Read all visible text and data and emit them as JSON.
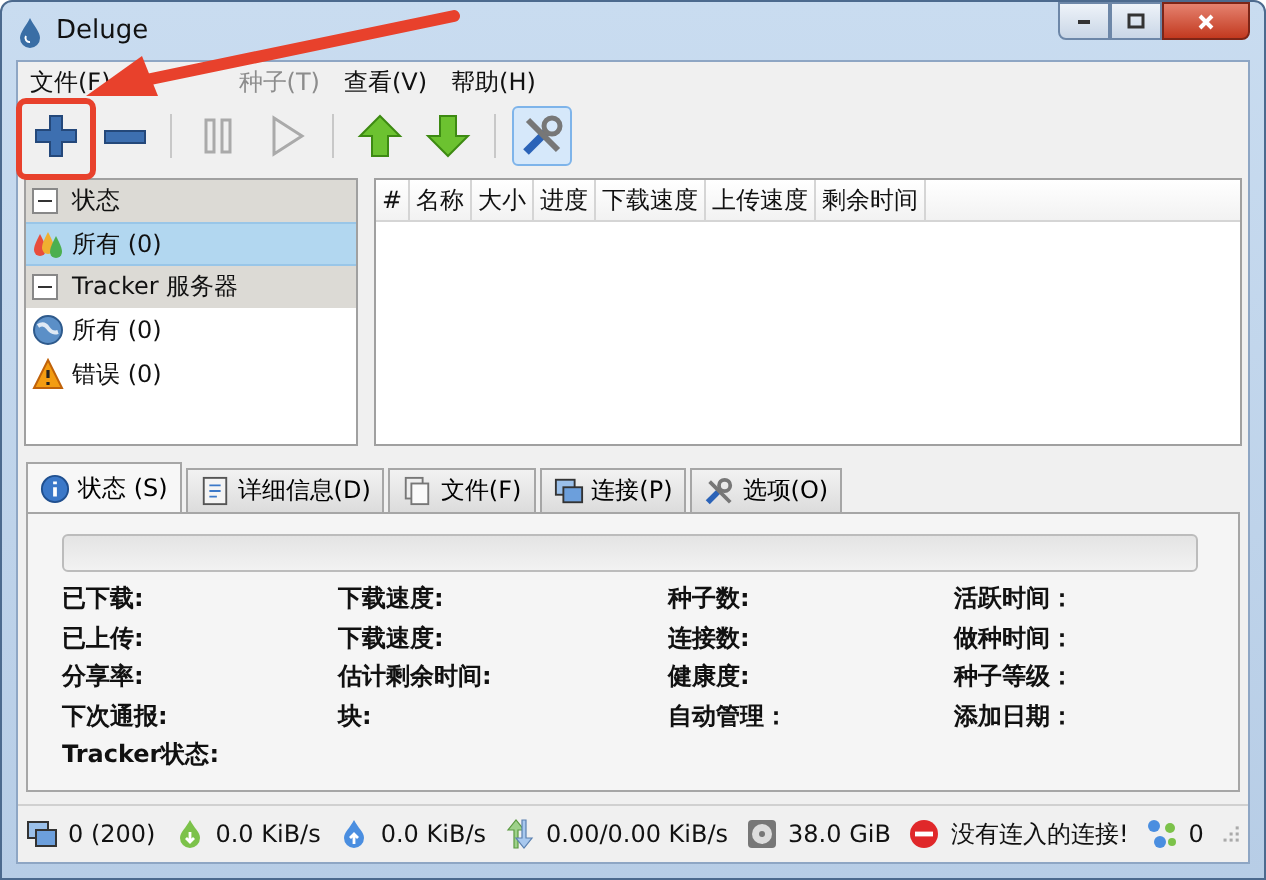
{
  "window": {
    "title": "Deluge"
  },
  "menu": [
    {
      "label": "文件(F)",
      "disabled": false
    },
    {
      "label": "种子(T)",
      "disabled": true
    },
    {
      "label": "查看(V)",
      "disabled": false
    },
    {
      "label": "帮助(H)",
      "disabled": false
    }
  ],
  "toolbar": [
    {
      "kind": "add",
      "disabled": false,
      "pressed": false
    },
    {
      "kind": "remove",
      "disabled": false,
      "pressed": false
    },
    {
      "kind": "separator"
    },
    {
      "kind": "pause",
      "disabled": true,
      "pressed": false
    },
    {
      "kind": "resume",
      "disabled": true,
      "pressed": false
    },
    {
      "kind": "separator"
    },
    {
      "kind": "up",
      "disabled": false,
      "pressed": false
    },
    {
      "kind": "down",
      "disabled": false,
      "pressed": false
    },
    {
      "kind": "separator"
    },
    {
      "kind": "preferences",
      "disabled": false,
      "pressed": true
    }
  ],
  "sidebar": {
    "groups": [
      {
        "label": "状态",
        "expanded": true,
        "items": [
          {
            "label": "所有 (0)",
            "kind": "all",
            "selected": true
          }
        ]
      },
      {
        "label": "Tracker 服务器",
        "expanded": true,
        "items": [
          {
            "label": "所有 (0)",
            "kind": "globe",
            "selected": false
          },
          {
            "label": "错误 (0)",
            "kind": "warning",
            "selected": false
          }
        ]
      }
    ]
  },
  "table": {
    "columns": [
      "#",
      "名称",
      "大小",
      "进度",
      "下载速度",
      "上传速度",
      "剩余时间"
    ]
  },
  "tabs": [
    {
      "label": "状态 (S)",
      "kind": "info",
      "selected": true
    },
    {
      "label": "详细信息(D)",
      "kind": "details",
      "selected": false
    },
    {
      "label": "文件(F)",
      "kind": "files",
      "selected": false
    },
    {
      "label": "连接(P)",
      "kind": "peers",
      "selected": false
    },
    {
      "label": "选项(O)",
      "kind": "options",
      "selected": false
    }
  ],
  "details": {
    "progress": {
      "level": 0
    },
    "columns": [
      [
        "已下载:",
        "已上传:",
        "分享率:",
        "下次通报:",
        "Tracker状态:"
      ],
      [
        "下载速度:",
        "下载速度:",
        "估计剩余时间:",
        "块:"
      ],
      [
        "种子数:",
        "连接数:",
        "健康度:",
        "自动管理："
      ],
      [
        "活跃时间：",
        "做种时间：",
        "种子等级：",
        "添加日期："
      ]
    ]
  },
  "status_bar": [
    {
      "kind": "connections",
      "text": "0 (200)"
    },
    {
      "kind": "download",
      "text": "0.0 KiB/s"
    },
    {
      "kind": "upload",
      "text": "0.0 KiB/s"
    },
    {
      "kind": "protocol",
      "text": "0.00/0.00 KiB/s"
    },
    {
      "kind": "disk",
      "text": "38.0 GiB"
    },
    {
      "kind": "no-incoming",
      "text": "没有连入的连接!"
    },
    {
      "kind": "dht",
      "text": "0"
    }
  ]
}
